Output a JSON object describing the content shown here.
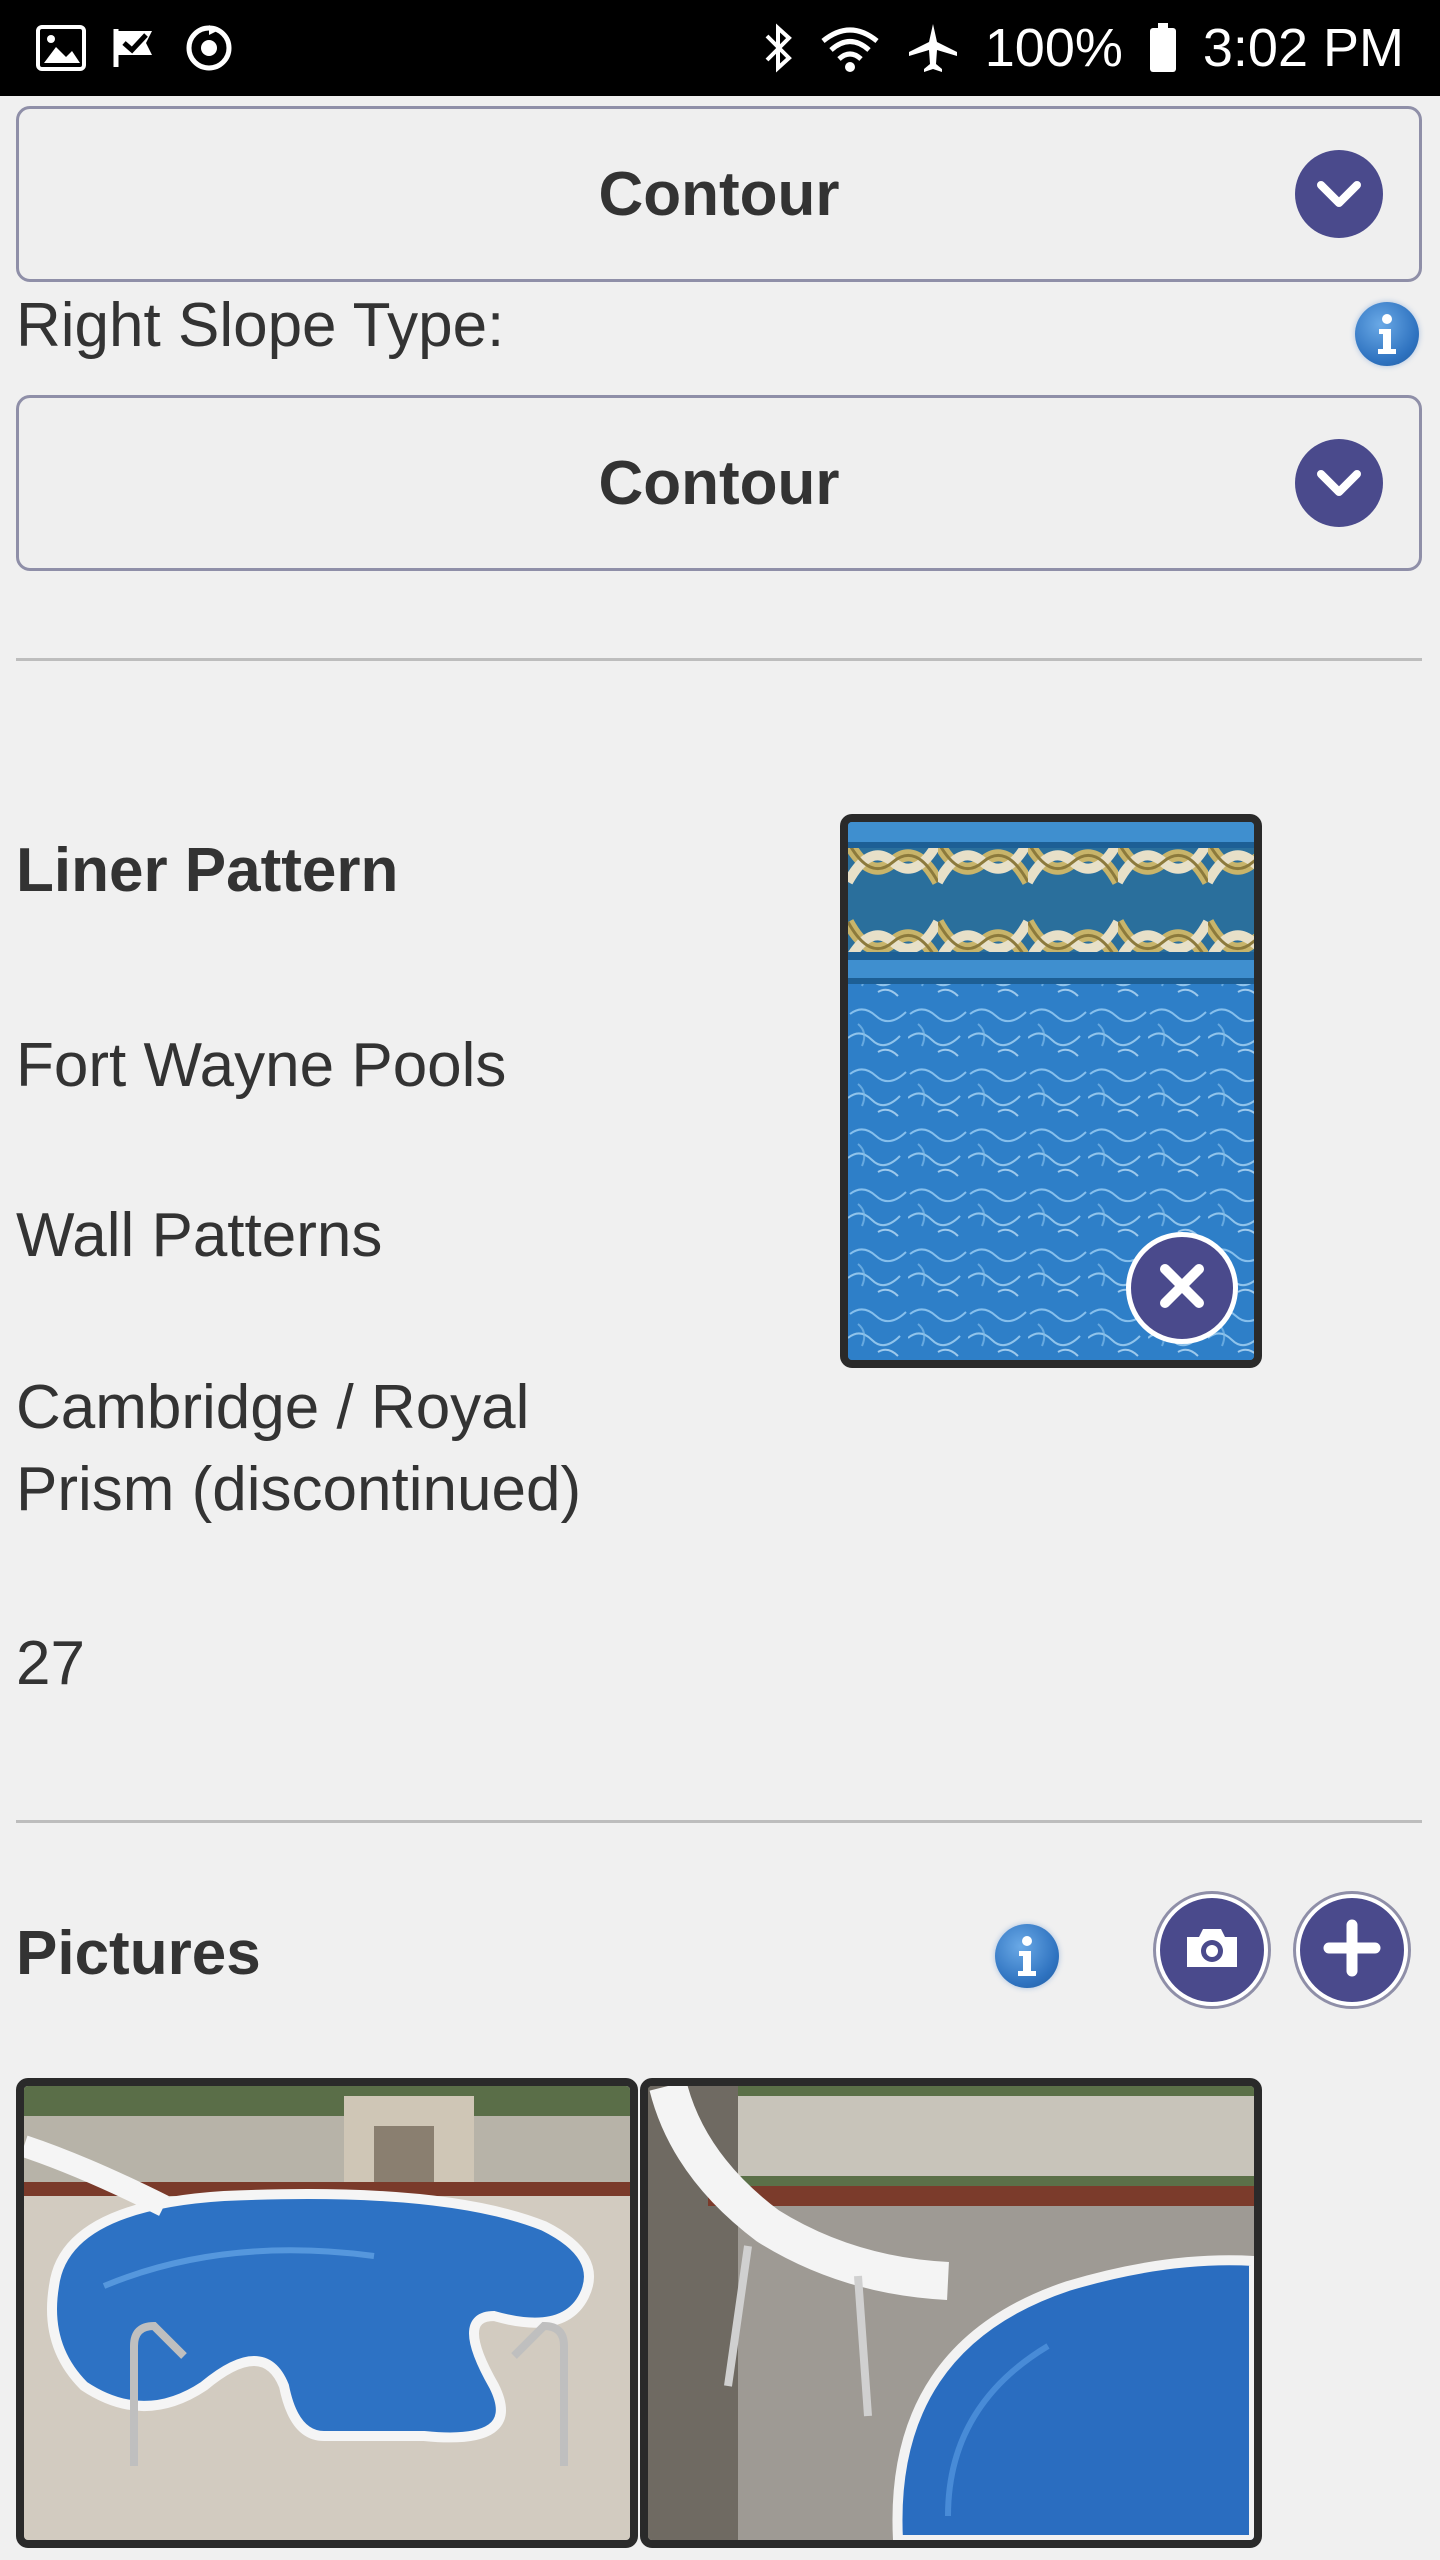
{
  "status_bar": {
    "battery": "100%",
    "time": "3:02 PM",
    "left_icons": [
      "image-icon",
      "check-flag-icon",
      "sync-icon"
    ],
    "right_icons": [
      "bluetooth-icon",
      "wifi-icon",
      "airplane-icon",
      "battery-icon"
    ]
  },
  "left_slope": {
    "value": "Contour"
  },
  "right_slope": {
    "label": "Right Slope Type:",
    "value": "Contour"
  },
  "liner": {
    "title": "Liner Pattern",
    "manufacturer": "Fort Wayne Pools",
    "category": "Wall Patterns",
    "pattern_line1": "Cambridge / Royal",
    "pattern_line2": "Prism (discontinued)",
    "code": "27"
  },
  "pictures": {
    "title": "Pictures"
  },
  "colors": {
    "accent": "#4a4a8c",
    "info": "#2f73c0",
    "background": "#f0f0f0"
  }
}
